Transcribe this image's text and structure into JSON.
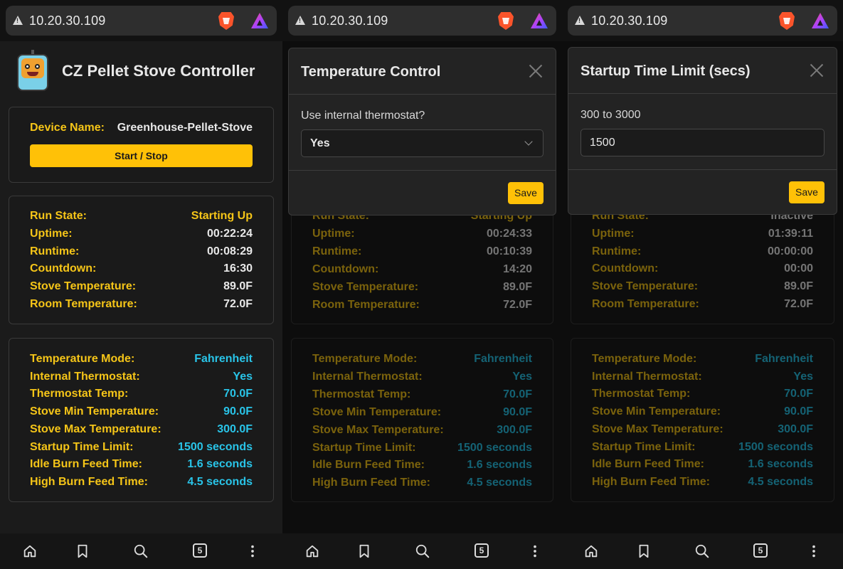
{
  "url": "10.20.30.109",
  "app_title": "CZ Pellet Stove Controller",
  "device": {
    "label": "Device Name:",
    "value": "Greenhouse-Pellet-Stove",
    "button": "Start / Stop"
  },
  "state_labels": {
    "run_state": "Run State:",
    "uptime": "Uptime:",
    "runtime": "Runtime:",
    "countdown": "Countdown:",
    "stove_temp": "Stove Temperature:",
    "room_temp": "Room Temperature:"
  },
  "config_labels": {
    "mode": "Temperature Mode:",
    "thermostat": "Internal Thermostat:",
    "thermo_temp": "Thermostat Temp:",
    "min_temp": "Stove Min Temperature:",
    "max_temp": "Stove Max Temperature:",
    "startup_limit": "Startup Time Limit:",
    "idle_feed": "Idle Burn Feed Time:",
    "high_feed": "High Burn Feed Time:"
  },
  "config_values": {
    "mode": "Fahrenheit",
    "thermostat": "Yes",
    "thermo_temp": "70.0F",
    "min_temp": "90.0F",
    "max_temp": "300.0F",
    "startup_limit": "1500 seconds",
    "idle_feed": "1.6 seconds",
    "high_feed": "4.5 seconds"
  },
  "screens": [
    {
      "run_state": "Starting Up",
      "uptime": "00:22:24",
      "runtime": "00:08:29",
      "countdown": "16:30",
      "stove_temp": "89.0F",
      "room_temp": "72.0F"
    },
    {
      "run_state": "Starting Up",
      "uptime": "00:24:33",
      "runtime": "00:10:39",
      "countdown": "14:20",
      "stove_temp": "89.0F",
      "room_temp": "72.0F"
    },
    {
      "run_state": "Inactive",
      "uptime": "01:39:11",
      "runtime": "00:00:00",
      "countdown": "00:00",
      "stove_temp": "89.0F",
      "room_temp": "72.0F"
    }
  ],
  "modal_temp": {
    "title": "Temperature Control",
    "label": "Use internal thermostat?",
    "selected": "Yes",
    "save": "Save"
  },
  "modal_startup": {
    "title": "Startup Time Limit (secs)",
    "label": "300 to 3000",
    "value": "1500",
    "save": "Save"
  },
  "nav": {
    "tab_count": "5"
  },
  "colors": {
    "accent": "#ffc107",
    "label": "#f5c518",
    "value_cyan": "#29c4e8"
  }
}
